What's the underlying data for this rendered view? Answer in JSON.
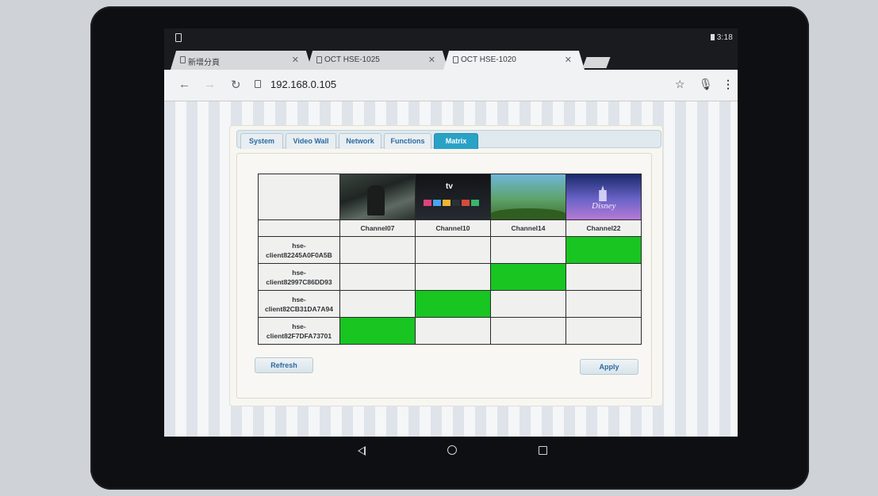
{
  "statusbar": {
    "time": "3:18"
  },
  "browser_tabs": [
    {
      "title": "新增分頁",
      "active": false
    },
    {
      "title": "OCT HSE-1025",
      "active": false
    },
    {
      "title": "OCT HSE-1020",
      "active": true
    }
  ],
  "toolbar": {
    "url": "192.168.0.105",
    "icons": [
      "back-arrow-icon",
      "forward-arrow-icon",
      "reload-icon",
      "star-icon",
      "mic-icon",
      "more-vert-icon"
    ]
  },
  "page_tabs": [
    {
      "label": "System",
      "active": false
    },
    {
      "label": "Video Wall",
      "active": false
    },
    {
      "label": "Network",
      "active": false
    },
    {
      "label": "Functions",
      "active": false
    },
    {
      "label": "Matrix",
      "active": true
    }
  ],
  "matrix": {
    "channels": [
      "Channel07",
      "Channel10",
      "Channel14",
      "Channel22"
    ],
    "thumbnails": [
      "game-soldier",
      "apple-tv",
      "cartoon-landscape",
      "disney-castle"
    ],
    "thumbnail_text": {
      "apple_tv": "tv",
      "disney": "Disney"
    },
    "clients": [
      {
        "label_line1": "hse-",
        "label_line2": "client82245A0F0A5B",
        "selected_channel_index": 3
      },
      {
        "label_line1": "hse-",
        "label_line2": "client82997C86DD93",
        "selected_channel_index": 2
      },
      {
        "label_line1": "hse-",
        "label_line2": "client82CB31DA7A94",
        "selected_channel_index": 1
      },
      {
        "label_line1": "hse-",
        "label_line2": "client82F7DFA73701",
        "selected_channel_index": 0
      }
    ],
    "selected_color": "#18c521"
  },
  "buttons": {
    "refresh": "Refresh",
    "apply": "Apply"
  },
  "colors": {
    "active_tab": "#2aa2c6",
    "tab_text": "#2c6aa0"
  }
}
